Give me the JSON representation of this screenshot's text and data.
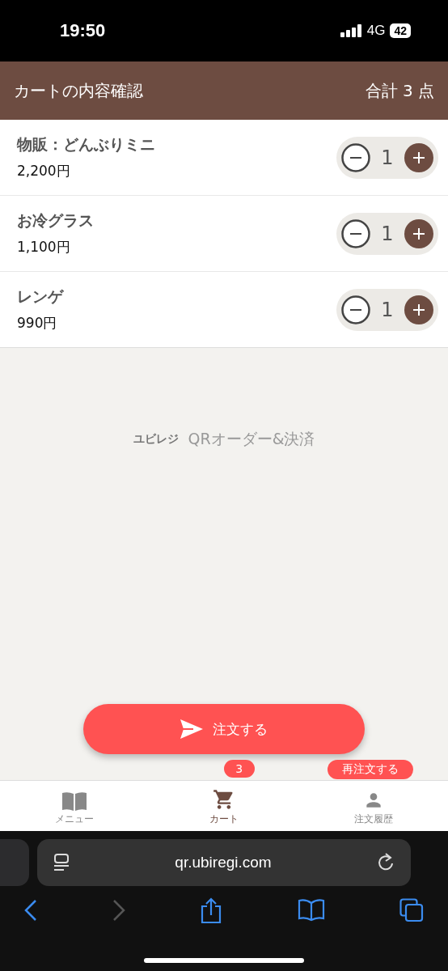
{
  "status_bar": {
    "time": "19:50",
    "network": "4G",
    "battery": "42"
  },
  "header": {
    "title": "カートの内容確認",
    "total": "合計 3 点"
  },
  "cart_items": [
    {
      "name": "物販：どんぶりミニ",
      "price": "2,200円",
      "quantity": "1"
    },
    {
      "name": "お冷グラス",
      "price": "1,100円",
      "quantity": "1"
    },
    {
      "name": "レンゲ",
      "price": "990円",
      "quantity": "1"
    }
  ],
  "logo": {
    "brand": "ユビレジ",
    "product": "QRオーダー&決済"
  },
  "order_button": {
    "label": "注文する"
  },
  "tabs": [
    {
      "label": "メニュー",
      "kind": "menu",
      "selected": false
    },
    {
      "label": "カート",
      "kind": "cart",
      "selected": true,
      "badge": "3"
    },
    {
      "label": "注文履歴",
      "kind": "history",
      "selected": false,
      "badge": "再注文する"
    }
  ],
  "browser": {
    "url": "qr.ubiregi.com",
    "back_disabled": false,
    "forward_disabled": true
  }
}
